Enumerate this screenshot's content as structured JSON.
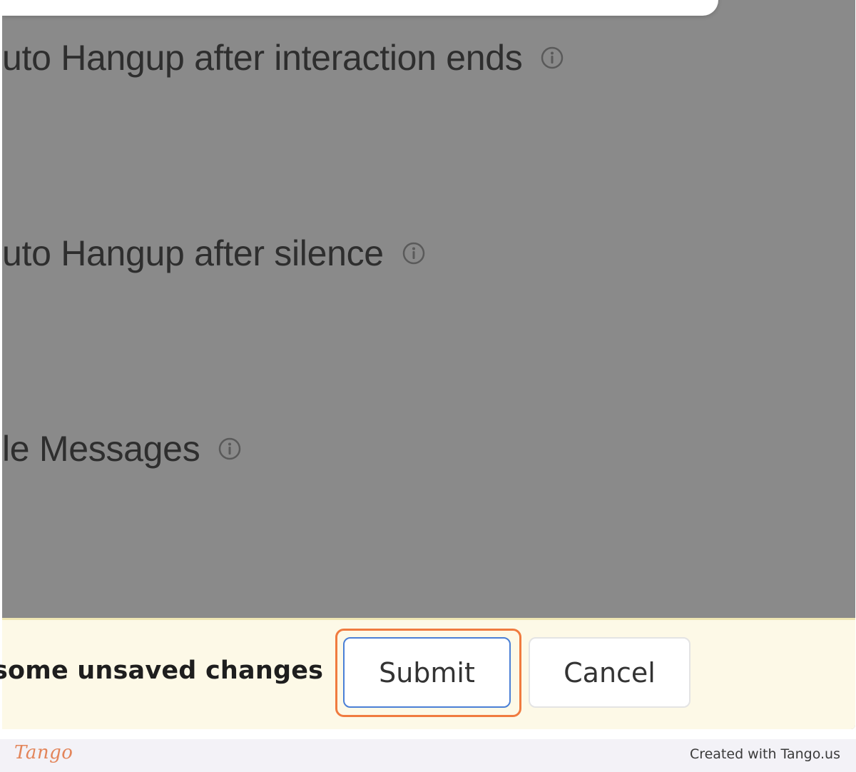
{
  "settings": {
    "rows": [
      {
        "label": "uto Hangup after interaction ends",
        "icon": "info-icon"
      },
      {
        "label": "uto Hangup after silence",
        "icon": "info-icon"
      },
      {
        "label": "le Messages",
        "icon": "info-icon"
      }
    ]
  },
  "unsaved_bar": {
    "message": "some unsaved changes",
    "submit_label": "Submit",
    "cancel_label": "Cancel"
  },
  "footer": {
    "logo": "Tango",
    "credit": "Created with Tango.us"
  },
  "colors": {
    "overlay": "#8a8a8a",
    "bar_background": "#fdf9e7",
    "highlight": "#f07b3f",
    "submit_border": "#4a7fd6",
    "logo": "#e3855a"
  }
}
